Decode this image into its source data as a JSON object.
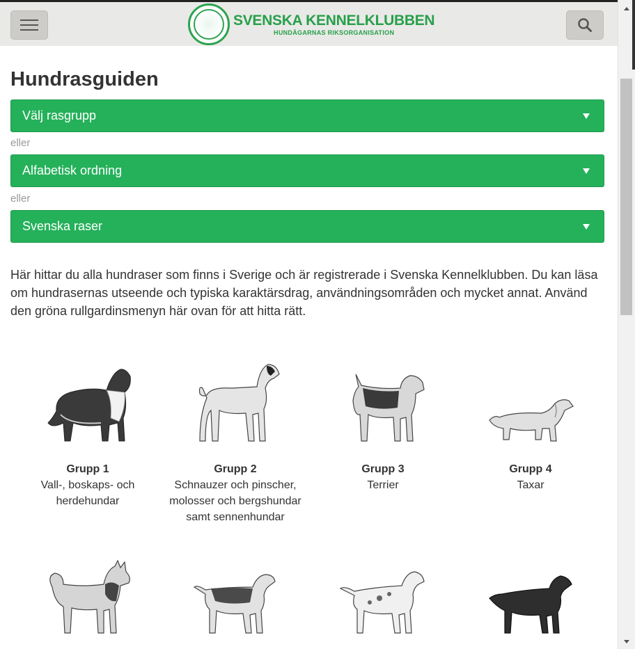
{
  "header": {
    "logo_title": "SVENSKA KENNELKLUBBEN",
    "logo_subtitle": "HUNDÄGARNAS RIKSORGANISATION",
    "menu_icon": "hamburger-icon",
    "search_icon": "search-icon"
  },
  "page": {
    "title": "Hundrasguiden",
    "dropdowns": [
      {
        "label": "Välj rasgrupp"
      },
      {
        "label": "Alfabetisk ordning"
      },
      {
        "label": "Svenska raser"
      }
    ],
    "or_text": "eller",
    "intro": "Här hittar du alla hundraser som finns i Sverige och är registrerade i Svenska Kennelklubben. Du kan läsa om hundrasernas utseende och typiska karaktärsdrag, användningsområden och mycket annat. Använd den gröna rullgardinsmenyn här ovan för att hitta rätt."
  },
  "groups": [
    {
      "title": "Grupp 1",
      "desc": "Vall-, boskaps- och herdehundar"
    },
    {
      "title": "Grupp 2",
      "desc": "Schnauzer och pinscher, molosser och bergshundar samt sennenhundar"
    },
    {
      "title": "Grupp 3",
      "desc": "Terrier"
    },
    {
      "title": "Grupp 4",
      "desc": "Taxar"
    }
  ],
  "colors": {
    "accent_green": "#24b15a",
    "logo_green": "#27a04a",
    "header_bg": "#e9e9e7"
  }
}
